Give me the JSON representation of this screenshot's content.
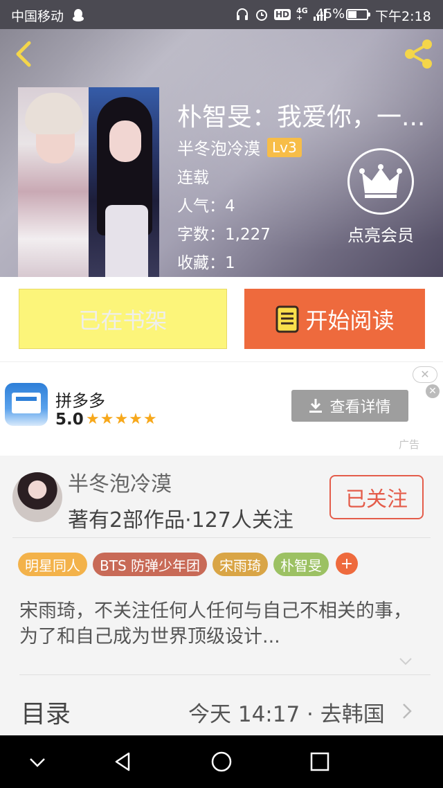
{
  "status_bar": {
    "carrier": "中国移动",
    "hd": "HD",
    "net_top": "4G",
    "net_bottom": "+",
    "battery_pct": "45%",
    "time": "下午2:18"
  },
  "header": {
    "title": "朴智旻：我爱你，一...",
    "author": "半冬泡冷漠",
    "level": "Lv3",
    "status": "连载",
    "popularity": "人气：4",
    "word_count": "字数：1,227",
    "favorites": "收藏：1",
    "vip_label": "点亮会员"
  },
  "actions": {
    "shelf_label": "已在书架",
    "read_label": "开始阅读"
  },
  "ad": {
    "app_name": "拼多多",
    "rating": "5.0",
    "stars": "★★★★★",
    "details_label": "查看详情",
    "close": "✕",
    "ad_label": "广告"
  },
  "author_card": {
    "name": "半冬泡冷漠",
    "stats": "著有2部作品·127人关注",
    "follow_label": "已关注",
    "tags": [
      {
        "label": "明星同人",
        "color": "#f3b24a"
      },
      {
        "label": "BTS 防弹少年团",
        "color": "#c86a57"
      },
      {
        "label": "宋雨琦",
        "color": "#d9a546"
      },
      {
        "label": "朴智旻",
        "color": "#9cc163"
      },
      {
        "label": "+",
        "color": "#ee6a3d"
      }
    ],
    "description": "宋雨琦，不关注任何人任何与自己不相关的事，为了和自己成为世界顶级设计...",
    "toc_label": "目录",
    "toc_latest": "今天 14:17 · 去韩国"
  },
  "colors": {
    "accent_orange": "#ee6a3d",
    "shelf_yellow": "#fcf57a",
    "level_badge": "#f7bd48",
    "follow_red": "#e45c4a"
  }
}
